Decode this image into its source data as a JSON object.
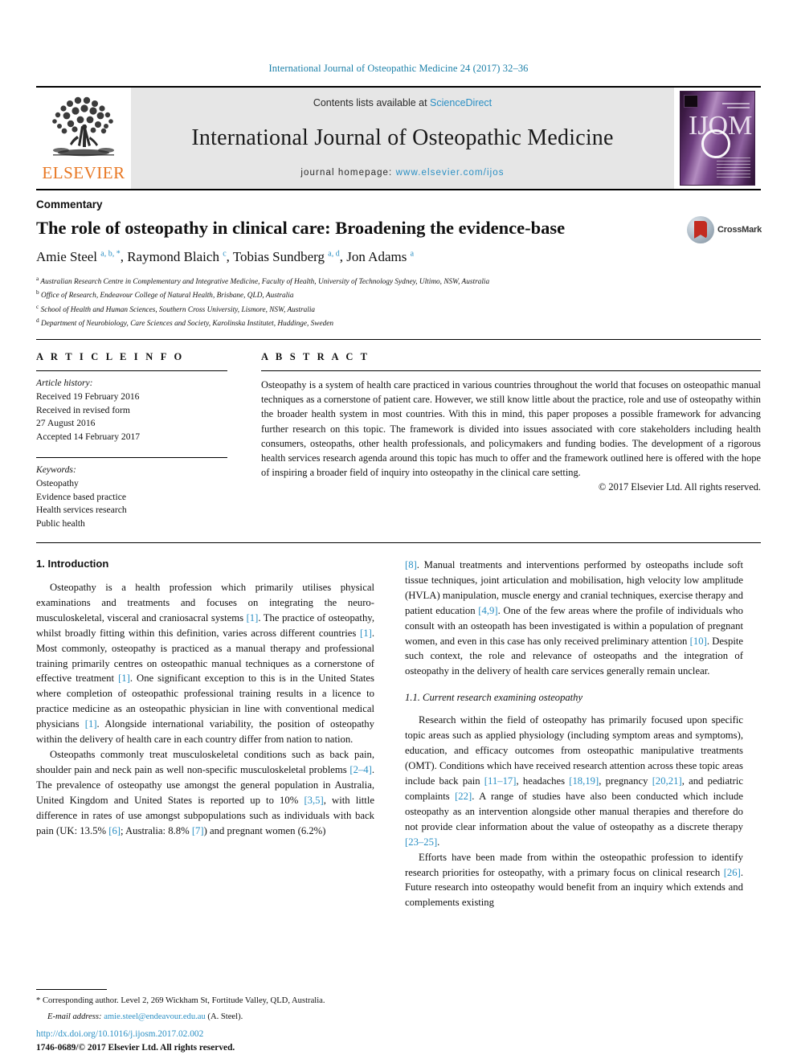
{
  "running_head": "International Journal of Osteopathic Medicine 24 (2017) 32–36",
  "masthead": {
    "publisher_name": "ELSEVIER",
    "contents_prefix": "Contents lists available at ",
    "contents_link": "ScienceDirect",
    "journal_title": "International Journal of Osteopathic Medicine",
    "homepage_prefix": "journal homepage: ",
    "homepage_url": "www.elsevier.com/ijos",
    "cover_letters": "IJOM"
  },
  "article": {
    "section_type": "Commentary",
    "title": "The role of osteopathy in clinical care: Broadening the evidence-base",
    "crossmark_label": "CrossMark",
    "authors_html": "Amie Steel <sup>a, b, *</sup>, Raymond Blaich <sup>c</sup>, Tobias Sundberg <sup>a, d</sup>, Jon Adams <sup>a</sup>",
    "affiliations": [
      {
        "marker": "a",
        "text": "Australian Research Centre in Complementary and Integrative Medicine, Faculty of Health, University of Technology Sydney, Ultimo, NSW, Australia"
      },
      {
        "marker": "b",
        "text": "Office of Research, Endeavour College of Natural Health, Brisbane, QLD, Australia"
      },
      {
        "marker": "c",
        "text": "School of Health and Human Sciences, Southern Cross University, Lismore, NSW, Australia"
      },
      {
        "marker": "d",
        "text": "Department of Neurobiology, Care Sciences and Society, Karolinska Institutet, Huddinge, Sweden"
      }
    ]
  },
  "article_info": {
    "label": "A R T I C L E   I N F O",
    "history_label": "Article history:",
    "history_lines": [
      "Received 19 February 2016",
      "Received in revised form",
      "27 August 2016",
      "Accepted 14 February 2017"
    ],
    "keywords_label": "Keywords:",
    "keywords": [
      "Osteopathy",
      "Evidence based practice",
      "Health services research",
      "Public health"
    ]
  },
  "abstract": {
    "label": "A B S T R A C T",
    "text": "Osteopathy is a system of health care practiced in various countries throughout the world that focuses on osteopathic manual techniques as a cornerstone of patient care. However, we still know little about the practice, role and use of osteopathy within the broader health system in most countries. With this in mind, this paper proposes a possible framework for advancing further research on this topic. The framework is divided into issues associated with core stakeholders including health consumers, osteopaths, other health professionals, and policymakers and funding bodies. The development of a rigorous health services research agenda around this topic has much to offer and the framework outlined here is offered with the hope of inspiring a broader field of inquiry into osteopathy in the clinical care setting.",
    "copyright": "© 2017 Elsevier Ltd. All rights reserved."
  },
  "body": {
    "left_column": {
      "section_heading": "1. Introduction",
      "paragraphs": [
        "Osteopathy is a health profession which primarily utilises physical examinations and treatments and focuses on integrating the neuro-musculoskeletal, visceral and craniosacral systems [1]. The practice of osteopathy, whilst broadly fitting within this definition, varies across different countries [1]. Most commonly, osteopathy is practiced as a manual therapy and professional training primarily centres on osteopathic manual techniques as a cornerstone of effective treatment [1]. One significant exception to this is in the United States where completion of osteopathic professional training results in a licence to practice medicine as an osteopathic physician in line with conventional medical physicians [1]. Alongside international variability, the position of osteopathy within the delivery of health care in each country differ from nation to nation.",
        "Osteopaths commonly treat musculoskeletal conditions such as back pain, shoulder pain and neck pain as well non-specific musculoskeletal problems [2–4]. The prevalence of osteopathy use amongst the general population in Australia, United Kingdom and United States is reported up to 10% [3,5], with little difference in rates of use amongst subpopulations such as individuals with back pain (UK: 13.5% [6]; Australia: 8.8% [7]) and pregnant women (6.2%)"
      ]
    },
    "right_column": {
      "paragraphs_top": [
        "[8]. Manual treatments and interventions performed by osteopaths include soft tissue techniques, joint articulation and mobilisation, high velocity low amplitude (HVLA) manipulation, muscle energy and cranial techniques, exercise therapy and patient education [4,9]. One of the few areas where the profile of individuals who consult with an osteopath has been investigated is within a population of pregnant women, and even in this case has only received preliminary attention [10]. Despite such context, the role and relevance of osteopaths and the integration of osteopathy in the delivery of health care services generally remain unclear."
      ],
      "subsection_heading": "1.1. Current research examining osteopathy",
      "paragraphs_bottom": [
        "Research within the field of osteopathy has primarily focused upon specific topic areas such as applied physiology (including symptom areas and symptoms), education, and efficacy outcomes from osteopathic manipulative treatments (OMT). Conditions which have received research attention across these topic areas include back pain [11–17], headaches [18,19], pregnancy [20,21], and pediatric complaints [22]. A range of studies have also been conducted which include osteopathy as an intervention alongside other manual therapies and therefore do not provide clear information about the value of osteopathy as a discrete therapy [23–25].",
        "Efforts have been made from within the osteopathic profession to identify research priorities for osteopathy, with a primary focus on clinical research [26]. Future research into osteopathy would benefit from an inquiry which extends and complements existing"
      ]
    }
  },
  "footer": {
    "corresponding_note": "* Corresponding author. Level 2, 269 Wickham St, Fortitude Valley, QLD, Australia.",
    "email_label": "E-mail address:",
    "email": "amie.steel@endeavour.edu.au",
    "email_suffix": "(A. Steel).",
    "doi": "http://dx.doi.org/10.1016/j.ijosm.2017.02.002",
    "issn_line": "1746-0689/© 2017 Elsevier Ltd. All rights reserved."
  },
  "colors": {
    "link_blue": "#2a8fc4",
    "running_head_blue": "#1a7fa8",
    "elsevier_orange": "#e87722",
    "band_gray": "#e6e6e6",
    "crossmark_red": "#c32b20"
  }
}
